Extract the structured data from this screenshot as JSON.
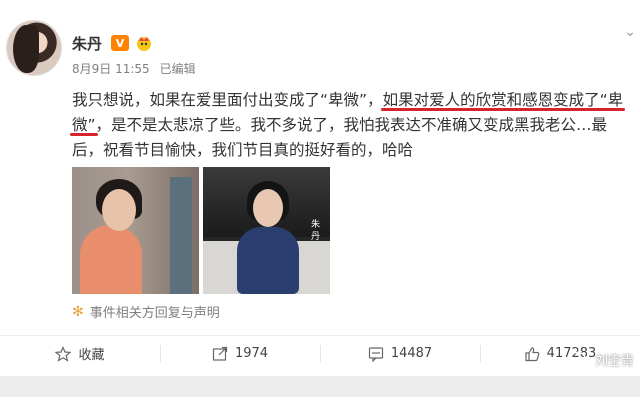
{
  "author": {
    "name": "朱丹",
    "verified_badge": "V"
  },
  "meta": {
    "date": "8月9日 11:55",
    "edited": "已编辑"
  },
  "post": {
    "lines": [
      [
        "我只想说，如果在爱里面付出变成了“卑微”，",
        "如果对爱人的欣赏和感恩变成了“卑"
      ],
      [
        "微”",
        "，是不是太悲凉了些。我不多说了，我怕我表达不准确又变成黑我老公…最"
      ],
      [
        "后，祝看节目愉快，我们节目真的挺好看的，哈哈"
      ]
    ]
  },
  "photos": {
    "photo2_name": "朱丹"
  },
  "related_link": "事件相关方回复与声明",
  "actions": {
    "favorite": "收藏",
    "repost": "1974",
    "comment": "14487",
    "like": "417283"
  },
  "watermark": "刘空青",
  "colors": {
    "underline": "#d8232a",
    "badge": "#ff8200"
  }
}
